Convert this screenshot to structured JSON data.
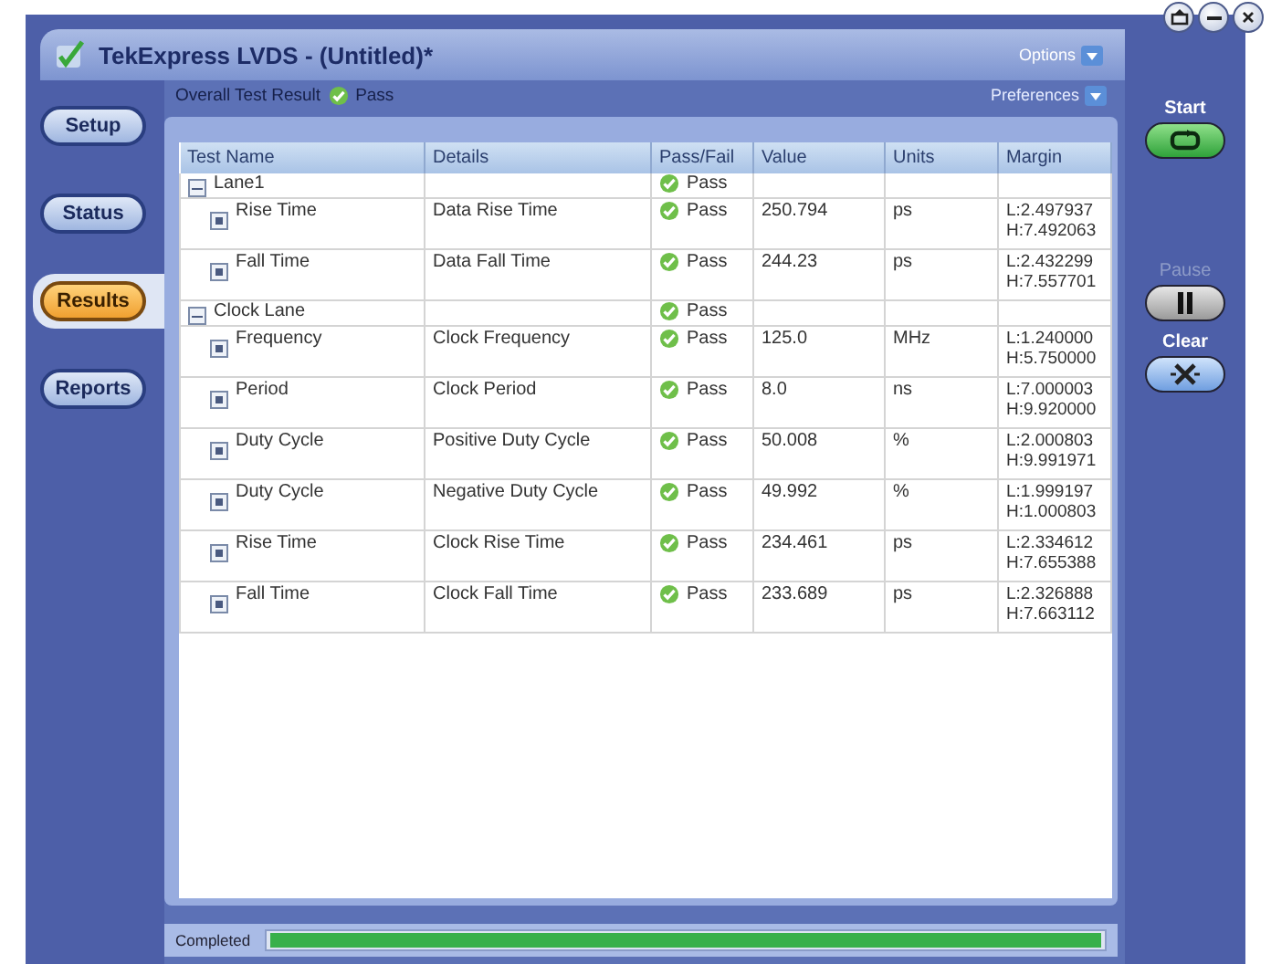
{
  "window": {
    "title": "TekExpress LVDS  -  (Untitled)*",
    "options_label": "Options"
  },
  "nav": [
    {
      "label": "Setup",
      "selected": false
    },
    {
      "label": "Status",
      "selected": false
    },
    {
      "label": "Results",
      "selected": true
    },
    {
      "label": "Reports",
      "selected": false
    }
  ],
  "summary": {
    "label": "Overall Test Result",
    "result": "Pass",
    "passed": true,
    "preferences_label": "Preferences"
  },
  "table": {
    "columns": [
      "Test Name",
      "Details",
      "Pass/Fail",
      "Value",
      "Units",
      "Margin"
    ],
    "groups": [
      {
        "name": "Lane1",
        "expanded": true,
        "result": "Pass",
        "passed": true,
        "children": [
          {
            "name": "Rise Time",
            "expanded": false,
            "details": "Data Rise Time",
            "result": "Pass",
            "passed": true,
            "value": "250.794",
            "units": "ps",
            "margin_low": "L:2.497937",
            "margin_high": "H:7.492063"
          },
          {
            "name": "Fall Time",
            "expanded": false,
            "details": "Data Fall Time",
            "result": "Pass",
            "passed": true,
            "value": "244.23",
            "units": "ps",
            "margin_low": "L:2.432299",
            "margin_high": "H:7.557701"
          }
        ]
      },
      {
        "name": "Clock Lane",
        "expanded": true,
        "result": "Pass",
        "passed": true,
        "children": [
          {
            "name": "Frequency",
            "expanded": false,
            "details": "Clock Frequency",
            "result": "Pass",
            "passed": true,
            "value": "125.0",
            "units": "MHz",
            "margin_low": "L:1.240000",
            "margin_high": "H:5.750000"
          },
          {
            "name": "Period",
            "expanded": false,
            "details": "Clock Period",
            "result": "Pass",
            "passed": true,
            "value": "8.0",
            "units": "ns",
            "margin_low": "L:7.000003",
            "margin_high": "H:9.920000"
          },
          {
            "name": "Duty Cycle",
            "expanded": false,
            "details": "Positive Duty Cycle",
            "result": "Pass",
            "passed": true,
            "value": "50.008",
            "units": "%",
            "margin_low": "L:2.000803",
            "margin_high": "H:9.991971"
          },
          {
            "name": "Duty Cycle",
            "expanded": false,
            "details": "Negative Duty Cycle",
            "result": "Pass",
            "passed": true,
            "value": "49.992",
            "units": "%",
            "margin_low": "L:1.999197",
            "margin_high": "H:1.000803"
          },
          {
            "name": "Rise Time",
            "expanded": false,
            "details": "Clock Rise Time",
            "result": "Pass",
            "passed": true,
            "value": "234.461",
            "units": "ps",
            "margin_low": "L:2.334612",
            "margin_high": "H:7.655388"
          },
          {
            "name": "Fall Time",
            "expanded": false,
            "details": "Clock Fall Time",
            "result": "Pass",
            "passed": true,
            "value": "233.689",
            "units": "ps",
            "margin_low": "L:2.326888",
            "margin_high": "H:7.663112"
          }
        ]
      }
    ]
  },
  "controls": [
    {
      "kind": "start",
      "label": "Start",
      "disabled": false
    },
    {
      "kind": "pause",
      "label": "Pause",
      "disabled": true
    },
    {
      "kind": "clear",
      "label": "Clear",
      "disabled": false
    }
  ],
  "status_bar": {
    "label": "Completed",
    "level": 1.0
  }
}
